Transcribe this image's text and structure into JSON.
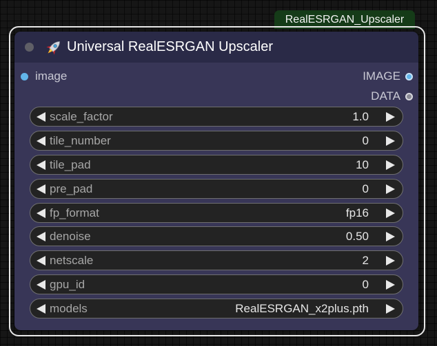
{
  "badge": {
    "label": "RealESRGAN_Upscaler"
  },
  "node": {
    "title": "Universal RealESRGAN Upscaler",
    "title_icon": "rocket-icon",
    "inputs": [
      {
        "label": "image",
        "color": "#62b5ea"
      }
    ],
    "outputs": [
      {
        "label": "IMAGE",
        "color": "#62b5ea"
      },
      {
        "label": "DATA",
        "color": "#8a8a95"
      }
    ],
    "widgets": [
      {
        "label": "scale_factor",
        "value": "1.0"
      },
      {
        "label": "tile_number",
        "value": "0"
      },
      {
        "label": "tile_pad",
        "value": "10"
      },
      {
        "label": "pre_pad",
        "value": "0"
      },
      {
        "label": "fp_format",
        "value": "fp16"
      },
      {
        "label": "denoise",
        "value": "0.50"
      },
      {
        "label": "netscale",
        "value": "2"
      },
      {
        "label": "gpu_id",
        "value": "0"
      },
      {
        "label": "models",
        "value": "RealESRGAN_x2plus.pth"
      }
    ]
  },
  "colors": {
    "node_body": "#383657",
    "node_title": "#2a2a47",
    "badge_bg": "#153b18",
    "selection_outline": "#e8e8e8"
  }
}
